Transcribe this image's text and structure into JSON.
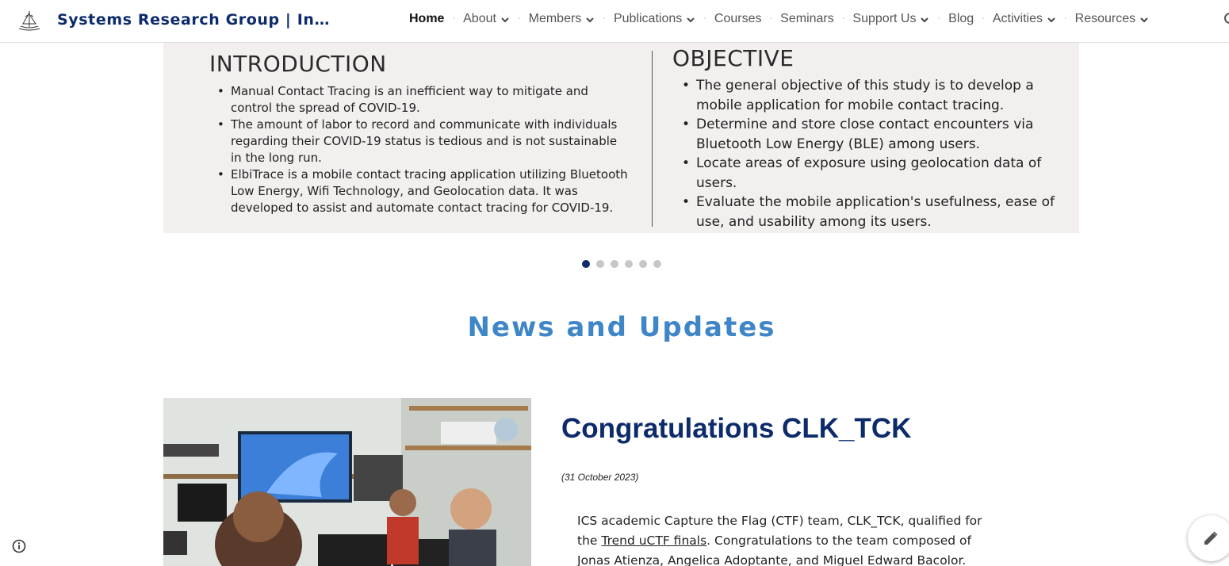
{
  "header": {
    "site_title": "Systems Research Group | Instit…",
    "nav": [
      {
        "label": "Home",
        "active": true,
        "dropdown": false
      },
      {
        "label": "About",
        "dropdown": true
      },
      {
        "label": "Members",
        "dropdown": true
      },
      {
        "label": "Publications",
        "dropdown": true
      },
      {
        "label": "Courses",
        "dropdown": false
      },
      {
        "label": "Seminars",
        "dropdown": false
      },
      {
        "label": "Support Us",
        "dropdown": true
      },
      {
        "label": "Blog",
        "dropdown": false
      },
      {
        "label": "Activities",
        "dropdown": true
      },
      {
        "label": "Resources",
        "dropdown": true
      }
    ],
    "separator": "·"
  },
  "carousel": {
    "introduction": {
      "heading": "INTRODUCTION",
      "bullets": [
        "Manual Contact Tracing is an inefficient way to mitigate and control the spread of COVID-19.",
        "The amount of labor to record and communicate with individuals regarding their COVID-19 status is tedious and is not sustainable in the long run.",
        "ElbiTrace is a  mobile contact tracing application utilizing Bluetooth Low Energy, Wifi Technology, and Geolocation data. It was developed to assist and automate contact tracing for COVID-19."
      ]
    },
    "objective": {
      "heading": "OBJECTIVE",
      "bullets": [
        "The general objective of this study is to develop a mobile application for mobile contact tracing.",
        "Determine and store close contact encounters via Bluetooth Low Energy (BLE) among users.",
        "Locate areas of exposure using geolocation data of users.",
        "Evaluate the mobile application's usefulness, ease of use, and usability among its users."
      ]
    },
    "slide_count": 6,
    "active_slide": 1
  },
  "news": {
    "heading": "News and Updates",
    "article": {
      "title": "Congratulations CLK_TCK",
      "date": "(31 October 2023)",
      "body_before_link": "ICS academic Capture the Flag (CTF) team, CLK_TCK, qualified for the ",
      "link_text": "Trend uCTF finals",
      "body_after_link": ". Congratulations to the team composed of  Jonas Atienza, Angelica Adoptante, and Miguel Edward Bacolor."
    }
  },
  "icons": {
    "logo": "institute-logo",
    "chevron": "chevron-down-icon",
    "search": "search-icon",
    "info": "info-icon",
    "edit": "pencil-icon"
  },
  "colors": {
    "title_navy": "#0d2b6b",
    "news_blue": "#3e86c8",
    "slide_bg": "#f2efee",
    "dot_active": "#0d2b6b",
    "dot_inactive": "#c7c7c7"
  }
}
